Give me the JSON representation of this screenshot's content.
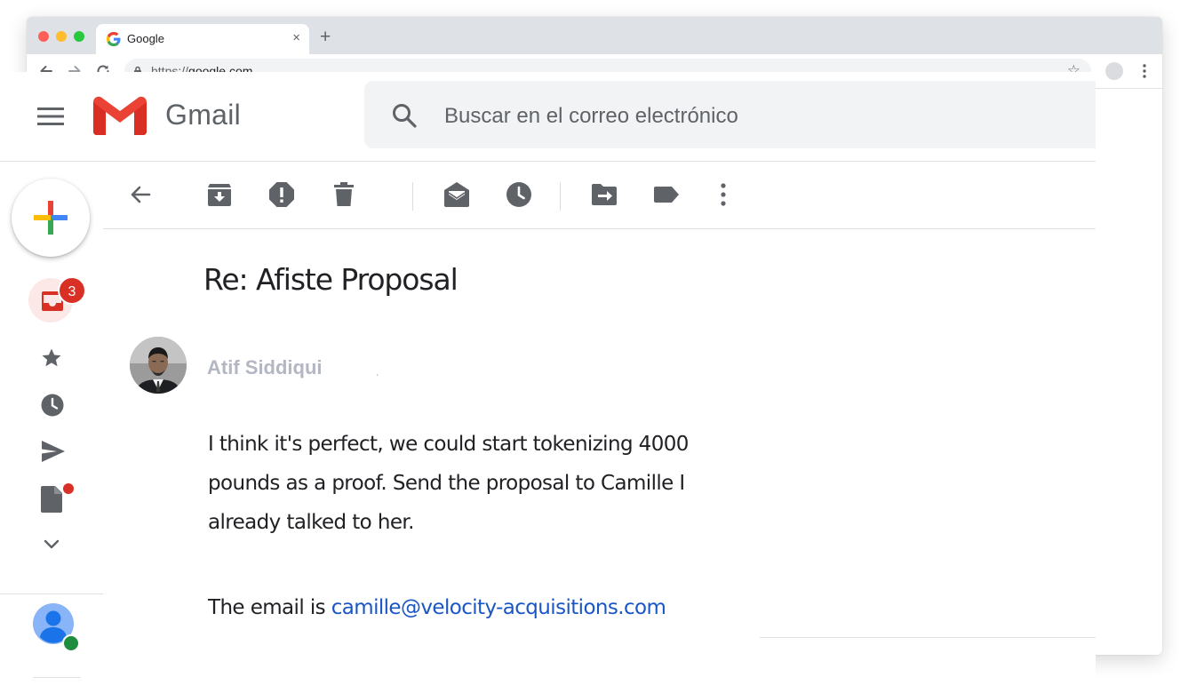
{
  "browser": {
    "tab_title": "Google",
    "tab_close": "×",
    "new_tab": "+",
    "url_scheme": "https://",
    "url_host": "google.com",
    "bookmark_star": "☆"
  },
  "gmail": {
    "product_name": "Gmail",
    "search_placeholder": "Buscar en el correo electrónico"
  },
  "sidebar": {
    "inbox_unread_count": "3",
    "items": [
      {
        "name": "inbox",
        "icon": "inbox-icon"
      },
      {
        "name": "starred",
        "icon": "star-icon"
      },
      {
        "name": "snoozed",
        "icon": "clock-icon"
      },
      {
        "name": "sent",
        "icon": "send-icon"
      },
      {
        "name": "drafts",
        "icon": "draft-icon"
      },
      {
        "name": "more",
        "icon": "chevron-down-icon"
      }
    ]
  },
  "toolbar": {
    "icons": [
      "back-arrow-icon",
      "archive-icon",
      "report-spam-icon",
      "delete-icon",
      "mark-unread-icon",
      "snooze-icon",
      "move-to-icon",
      "label-icon",
      "more-vert-icon"
    ]
  },
  "message": {
    "subject": "Re: Afiste Proposal",
    "sender_name": "Atif Siddiqui",
    "sender_mark": "،",
    "body_lines": [
      "I think it's perfect, we could start tokenizing 4000",
      "pounds as a proof. Send the proposal to Camille I",
      "already talked to her."
    ],
    "email_prefix": "The email is ",
    "email_address": "camille@velocity-acquisitions.com"
  },
  "colors": {
    "gmail_red": "#ea4335",
    "badge_red": "#d93025",
    "link_blue": "#1a56c5",
    "sender_gray": "#b3b6c3",
    "presence_green": "#1e8e3e"
  }
}
